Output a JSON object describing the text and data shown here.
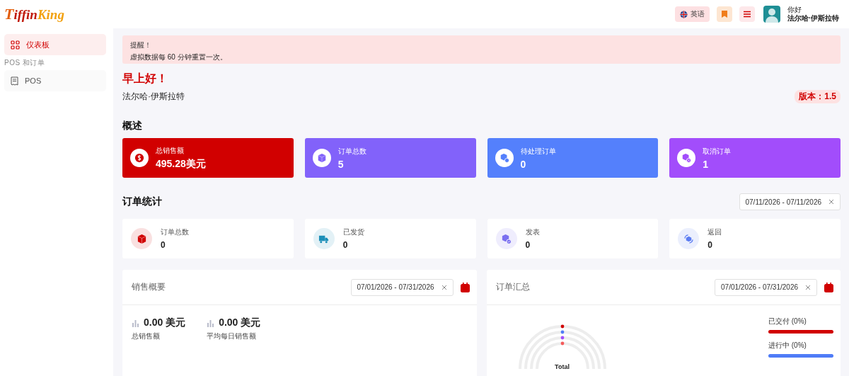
{
  "header": {
    "logo": {
      "part_1": "T",
      "part_2": "iffin",
      "part_3": "King"
    },
    "language": "英语",
    "greeting": "你好",
    "user_name": "法尔哈·伊斯拉特"
  },
  "sidebar": {
    "items": [
      {
        "label": "仪表板",
        "selected": true,
        "kind": "grid"
      }
    ],
    "section": "POS 和订单",
    "section_items": [
      {
        "label": "POS",
        "selected": false,
        "kind": "receipt"
      }
    ]
  },
  "alert": {
    "title": "提醒！",
    "message": "虚拟数据每 60 分钟重置一次。"
  },
  "welcome": {
    "greeting": "早上好！",
    "name": "法尔哈·伊斯拉特",
    "version": "版本：1.5"
  },
  "overview": {
    "title": "概述",
    "cards": [
      {
        "label": "总销售额",
        "value": "495.28美元",
        "kind": "dollar",
        "color": "#d10000"
      },
      {
        "label": "订单总数",
        "value": "5",
        "kind": "box",
        "color": "#8262fa"
      },
      {
        "label": "待处理订单",
        "value": "0",
        "kind": "pending",
        "color": "#5480fc"
      },
      {
        "label": "取消订单",
        "value": "1",
        "kind": "cancel",
        "color": "#a24dfb"
      }
    ]
  },
  "order_stats": {
    "title": "订单统计",
    "date_range": "07/11/2026 - 07/11/2026",
    "cards": [
      {
        "label": "订单总数",
        "value": "0",
        "kind": "box",
        "color": "#d10000"
      },
      {
        "label": "已发货",
        "value": "0",
        "kind": "truck",
        "color": "#1c8fb8"
      },
      {
        "label": "发表",
        "value": "0",
        "kind": "check",
        "color": "#7a6ff0"
      },
      {
        "label": "返回",
        "value": "0",
        "kind": "return",
        "color": "#5b7cf2"
      }
    ]
  },
  "sales_summary": {
    "title": "销售概要",
    "date_range": "07/01/2026 - 07/31/2026",
    "metrics": [
      {
        "value": "0.00 美元",
        "label": "总销售额"
      },
      {
        "value": "0.00 美元",
        "label": "平均每日销售额"
      }
    ]
  },
  "order_summary": {
    "title": "订单汇总",
    "date_range": "07/01/2026 - 07/31/2026",
    "center_label": "Total",
    "legend": [
      {
        "label": "已交付 (0%)",
        "color": "#d10000"
      },
      {
        "label": "进行中 (0%)",
        "color": "#4f7cf7"
      }
    ]
  }
}
